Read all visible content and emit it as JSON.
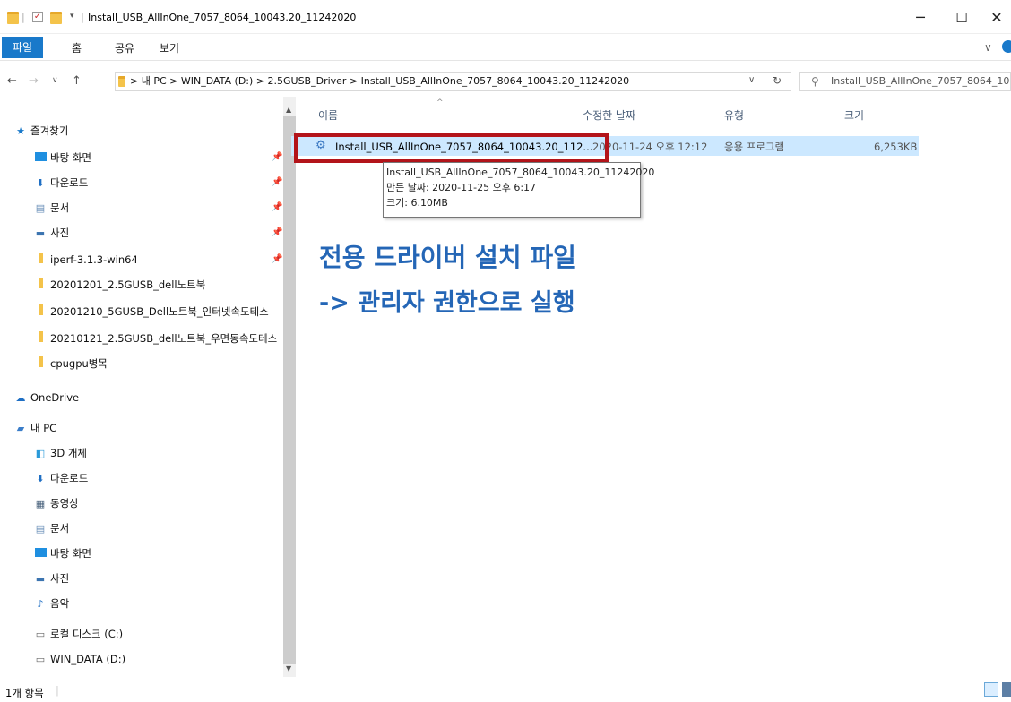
{
  "window": {
    "title": "Install_USB_AllInOne_7057_8064_10043.20_11242020",
    "minimize": "─",
    "maximize": "☐",
    "close": "✕"
  },
  "ribbon": {
    "tabs": [
      "파일",
      "홈",
      "공유",
      "보기"
    ]
  },
  "address": {
    "path": "> 내 PC  >  WIN_DATA (D:)  >  2.5GUSB_Driver  >  Install_USB_AllInOne_7057_8064_10043.20_11242020",
    "search_placeholder": "Install_USB_AllInOne_7057_8064_100..."
  },
  "sidebar": {
    "quick_access": "즐겨찾기",
    "quick_items": [
      {
        "label": "바탕 화면",
        "icon": "desktop-icon",
        "pinned": true
      },
      {
        "label": "다운로드",
        "icon": "download-icon",
        "pinned": true
      },
      {
        "label": "문서",
        "icon": "document-icon",
        "pinned": true
      },
      {
        "label": "사진",
        "icon": "pictures-icon",
        "pinned": true
      },
      {
        "label": "iperf-3.1.3-win64",
        "icon": "folder-icon",
        "pinned": true
      },
      {
        "label": "20201201_2.5GUSB_dell노트북",
        "icon": "folder-icon",
        "pinned": false
      },
      {
        "label": "20201210_5GUSB_Dell노트북_인터넷속도테스",
        "icon": "folder-icon",
        "pinned": false
      },
      {
        "label": "20210121_2.5GUSB_dell노트북_우면동속도테스",
        "icon": "folder-icon",
        "pinned": false
      },
      {
        "label": "cpugpu병목",
        "icon": "folder-icon",
        "pinned": false
      }
    ],
    "onedrive": "OneDrive",
    "this_pc": "내 PC",
    "pc_items": [
      {
        "label": "3D 개체",
        "icon": "3d-objects-icon"
      },
      {
        "label": "다운로드",
        "icon": "download-icon"
      },
      {
        "label": "동영상",
        "icon": "videos-icon"
      },
      {
        "label": "문서",
        "icon": "document-icon"
      },
      {
        "label": "바탕 화면",
        "icon": "desktop-icon"
      },
      {
        "label": "사진",
        "icon": "pictures-icon"
      },
      {
        "label": "음악",
        "icon": "music-icon"
      },
      {
        "label": "로컬 디스크 (C:)",
        "icon": "drive-icon"
      },
      {
        "label": "WIN_DATA (D:)",
        "icon": "drive-icon"
      }
    ]
  },
  "columns": {
    "name": "이름",
    "date": "수정한 날짜",
    "type": "유형",
    "size": "크기"
  },
  "files": [
    {
      "name": "Install_USB_AllInOne_7057_8064_10043.20_112...",
      "date": "2020-11-24 오후 12:12",
      "type": "응용 프로그램",
      "size": "6,253KB"
    }
  ],
  "tooltip": {
    "line1": "Install_USB_AllInOne_7057_8064_10043.20_11242020",
    "line2": "만든 날짜: 2020-11-25 오후 6:17",
    "line3": "크기: 6.10MB"
  },
  "annotation": {
    "line1": "전용 드라이버 설치 파일",
    "line2": "-> 관리자 권한으로 실행",
    "box_color": "#b3141a",
    "text_color": "#2466b6"
  },
  "status": {
    "items_count": "1개 항목"
  },
  "colors": {
    "accent": "#1979ca",
    "selection": "#cce8ff"
  }
}
